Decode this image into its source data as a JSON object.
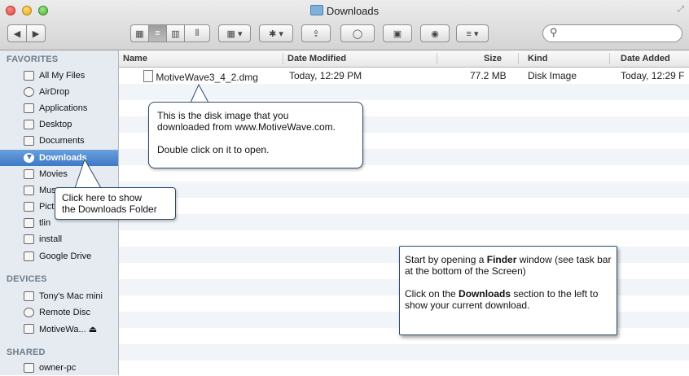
{
  "window": {
    "title": "Downloads"
  },
  "toolbar": {
    "back": "◀",
    "forward": "▶",
    "view_icon": "▦",
    "view_list": "≡",
    "view_columns": "▥",
    "view_coverflow": "⦀",
    "arrange": "▦ ▾",
    "action": "✱ ▾",
    "share": "⇪",
    "tags": "◯",
    "new_folder": "▣",
    "quicklook": "◉",
    "arrange2": "≡ ▾",
    "search_icon": "⚲"
  },
  "sidebar": {
    "favorites_header": "FAVORITES",
    "favorites": [
      {
        "label": "All My Files",
        "icon": "all-files-icon"
      },
      {
        "label": "AirDrop",
        "icon": "airdrop-icon"
      },
      {
        "label": "Applications",
        "icon": "applications-icon"
      },
      {
        "label": "Desktop",
        "icon": "desktop-icon"
      },
      {
        "label": "Documents",
        "icon": "documents-icon"
      },
      {
        "label": "Downloads",
        "icon": "downloads-icon"
      },
      {
        "label": "Movies",
        "icon": "movies-icon"
      },
      {
        "label": "Mus",
        "icon": "music-icon"
      },
      {
        "label": "Pict",
        "icon": "pictures-icon"
      },
      {
        "label": "tlin",
        "icon": "home-icon"
      },
      {
        "label": "install",
        "icon": "folder-icon"
      },
      {
        "label": "Google Drive",
        "icon": "folder-icon"
      }
    ],
    "devices_header": "DEVICES",
    "devices": [
      {
        "label": "Tony's Mac mini",
        "icon": "computer-icon"
      },
      {
        "label": "Remote Disc",
        "icon": "disc-icon"
      },
      {
        "label": "MotiveWa... ⏏",
        "icon": "disk-image-icon"
      }
    ],
    "shared_header": "SHARED",
    "shared": [
      {
        "label": "owner-pc",
        "icon": "network-pc-icon"
      }
    ]
  },
  "list": {
    "columns": [
      "Name",
      "Date Modified",
      "Size",
      "Kind",
      "Date Added"
    ],
    "rows": [
      {
        "name": "MotiveWave3_4_2.dmg",
        "date_modified": "Today, 12:29 PM",
        "size": "77.2 MB",
        "kind": "Disk Image",
        "date_added": "Today, 12:29 F"
      }
    ]
  },
  "callouts": {
    "disk_image": {
      "line1": "This is the disk image that you",
      "line2": "downloaded from www.MotiveWave.com.",
      "line3": "Double click on it to open."
    },
    "downloads": {
      "line1": "Click here to show",
      "line2": "the Downloads Folder"
    },
    "instructions": {
      "p1_a": "Start by opening a ",
      "p1_b": "Finder",
      "p1_c": " window (see task bar at the bottom of the Screen)",
      "p2_a": "Click on the ",
      "p2_b": "Downloads",
      "p2_c": " section to the left to show your current download."
    }
  },
  "colors": {
    "selection": "#3f78c5",
    "sidebar_bg": "#e6ebf1",
    "callout_border": "#2d4d6d"
  }
}
